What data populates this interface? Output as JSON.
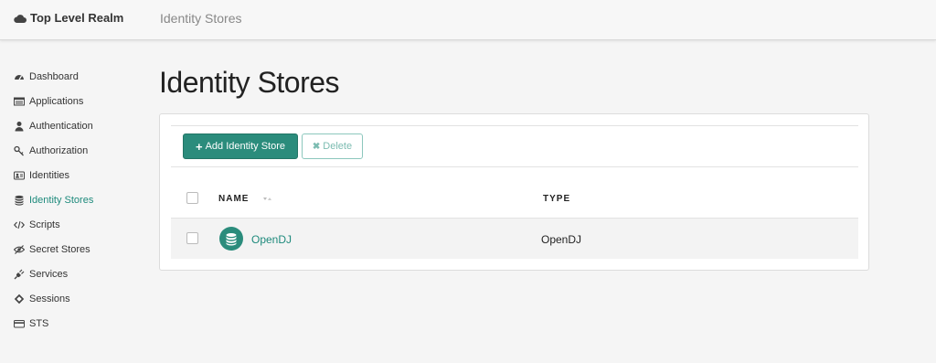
{
  "header": {
    "realm": "Top Level Realm",
    "breadcrumb": "Identity Stores"
  },
  "sidebar": {
    "items": [
      {
        "label": "Dashboard",
        "icon": "dashboard-icon"
      },
      {
        "label": "Applications",
        "icon": "applications-icon"
      },
      {
        "label": "Authentication",
        "icon": "user-icon"
      },
      {
        "label": "Authorization",
        "icon": "key-icon"
      },
      {
        "label": "Identities",
        "icon": "id-card-icon"
      },
      {
        "label": "Identity Stores",
        "icon": "database-icon",
        "active": true
      },
      {
        "label": "Scripts",
        "icon": "code-icon"
      },
      {
        "label": "Secret Stores",
        "icon": "eye-slash-icon"
      },
      {
        "label": "Services",
        "icon": "plug-icon"
      },
      {
        "label": "Sessions",
        "icon": "ticket-icon"
      },
      {
        "label": "STS",
        "icon": "credit-card-icon"
      }
    ]
  },
  "main": {
    "title": "Identity Stores",
    "toolbar": {
      "add_label": "Add Identity Store",
      "delete_label": "Delete"
    },
    "table": {
      "columns": [
        "NAME",
        "TYPE"
      ],
      "rows": [
        {
          "name": "OpenDJ",
          "type": "OpenDJ"
        }
      ]
    }
  },
  "colors": {
    "accent": "#2b8c7c",
    "active_link": "#1e8a7c"
  }
}
